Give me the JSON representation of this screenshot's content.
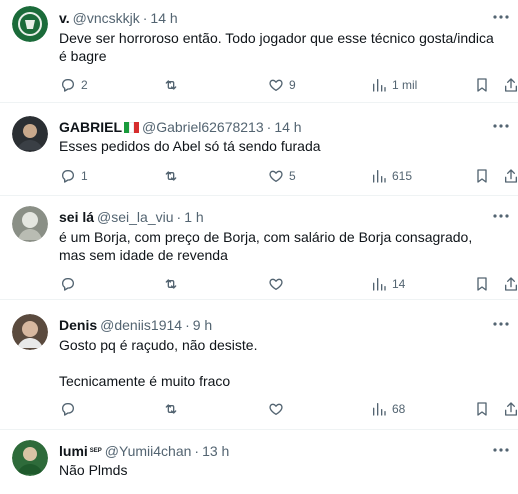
{
  "tweets": [
    {
      "name": "v.",
      "handle": "@vncskkjk",
      "time": "14 h",
      "text": "Deve ser horroroso então. Todo jogador que esse técnico gosta/indica é bagre",
      "replies": "2",
      "retweets": "",
      "likes": "9",
      "views": "1 mil"
    },
    {
      "name": "GABRIEL",
      "handle": "@Gabriel62678213",
      "time": "14 h",
      "text": "Esses pedidos do Abel só tá sendo furada",
      "replies": "1",
      "retweets": "",
      "likes": "5",
      "views": "615"
    },
    {
      "name": "sei lá",
      "handle": "@sei_la_viu",
      "time": "1 h",
      "text": "é um Borja, com preço de Borja, com salário de Borja consagrado, mas sem idade de revenda",
      "replies": "",
      "retweets": "",
      "likes": "",
      "views": "14"
    },
    {
      "name": "Denis",
      "handle": "@deniis1914",
      "time": "9 h",
      "text": "Gosto pq é raçudo, não desiste.\n\nTecnicamente é muito fraco",
      "replies": "",
      "retweets": "",
      "likes": "",
      "views": "68"
    },
    {
      "name": "lumi",
      "handle": "@Yumii4chan",
      "time": "13 h",
      "name_suffix": "SEP",
      "text": "Não Plmds",
      "replies": "",
      "retweets": "",
      "likes": "",
      "views": ""
    }
  ],
  "separator": "·",
  "icons": [
    "reply-icon",
    "retweet-icon",
    "like-icon",
    "views-icon",
    "bookmark-icon",
    "share-icon",
    "more-icon"
  ],
  "colors": {
    "text": "#0f1419",
    "muted": "#536471",
    "divider": "#eff3f4"
  }
}
